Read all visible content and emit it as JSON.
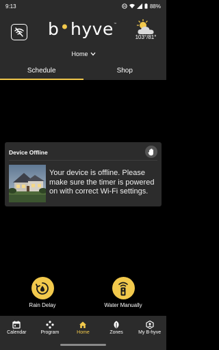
{
  "status_bar": {
    "time": "9:13",
    "battery": "88%"
  },
  "header": {
    "logo_left": "b",
    "logo_right": "hyve",
    "logo_tm": "™",
    "weather_temp": "103°/81°",
    "location": "Home"
  },
  "tabs": [
    {
      "label": "Schedule",
      "active": true
    },
    {
      "label": "Shop",
      "active": false
    }
  ],
  "device_card": {
    "title": "Device Offline",
    "message": "Your device is offline. Please make sure the timer is powered on with correct Wi-Fi settings."
  },
  "quick_actions": {
    "rain_delay": "Rain Delay",
    "water_manually": "Water Manually"
  },
  "bottom_nav": [
    {
      "label": "Calendar",
      "icon": "calendar-icon",
      "active": false
    },
    {
      "label": "Program",
      "icon": "program-icon",
      "active": false
    },
    {
      "label": "Home",
      "icon": "home-icon",
      "active": true
    },
    {
      "label": "Zones",
      "icon": "zones-icon",
      "active": false
    },
    {
      "label": "My B-hyve",
      "icon": "account-icon",
      "active": false
    }
  ],
  "colors": {
    "accent": "#f2c94c",
    "surface": "#2b2b2b",
    "card": "#2c2c2c",
    "background": "#000000"
  }
}
